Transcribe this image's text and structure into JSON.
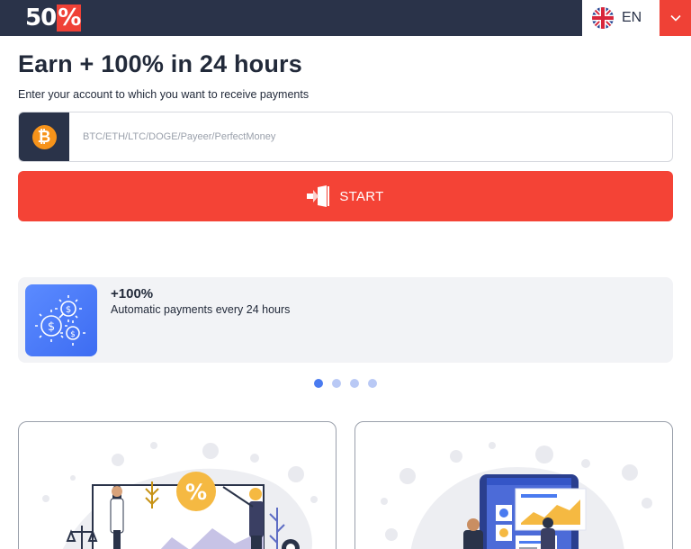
{
  "header": {
    "logo_number": "50",
    "logo_percent": "%",
    "language": "EN",
    "flag_icon": "uk-flag-icon",
    "dropdown_icon": "chevron-down-icon",
    "colors": {
      "bar": "#2a3349",
      "accent": "#ef4136"
    }
  },
  "hero": {
    "title": "Earn + 100% in 24 hours",
    "subtitle": "Enter your account to which you want to receive payments"
  },
  "wallet": {
    "icon": "bitcoin-icon",
    "btc_symbol": "₿",
    "placeholder": "BTC/ETH/LTC/DOGE/Payeer/PerfectMoney",
    "value": ""
  },
  "start_button": {
    "label": "START",
    "icon": "login-door-icon",
    "color": "#f44336"
  },
  "carousel": {
    "active_index": 0,
    "slide_count": 4,
    "slide": {
      "icon": "gears-dollar-icon",
      "title": "+100%",
      "description": "Automatic payments every 24 hours"
    }
  },
  "cards": [
    {
      "illustration": "percent-growth-illustration"
    },
    {
      "illustration": "crypto-dashboard-illustration"
    }
  ]
}
